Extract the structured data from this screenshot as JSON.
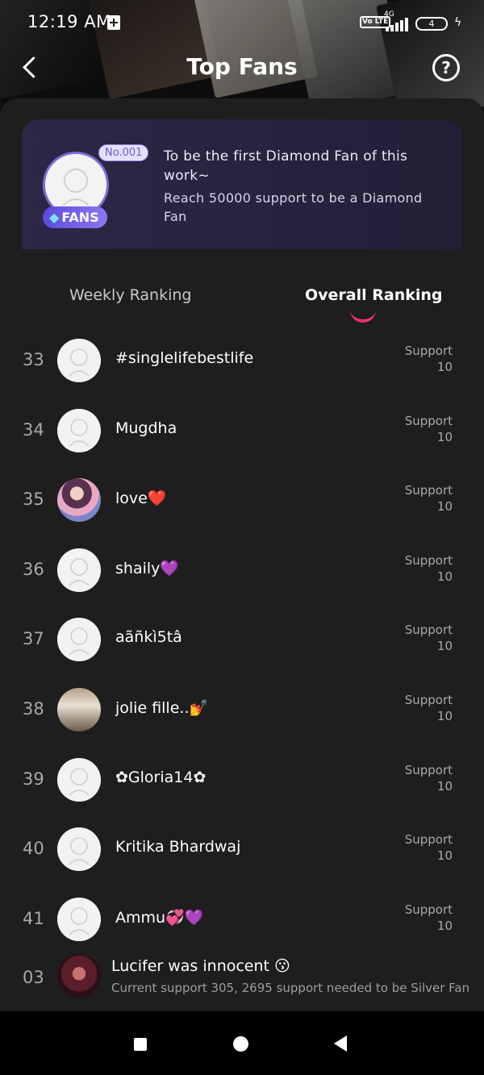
{
  "status_bar": {
    "time": "12:19 AM",
    "network": "4G",
    "volte": "Vo LTE",
    "battery": "4"
  },
  "header": {
    "title": "Top Fans"
  },
  "banner": {
    "rank_badge": "No.001",
    "fans_badge": "FANS",
    "line1": "To be the first Diamond Fan of this work~",
    "line2": "Reach 50000 support to be a Diamond Fan"
  },
  "tabs": [
    {
      "label": "Weekly Ranking",
      "active": false
    },
    {
      "label": "Overall Ranking",
      "active": true
    }
  ],
  "support_label": "Support",
  "rows": [
    {
      "rank": "33",
      "name": "#singlelifebestlife",
      "support": "10"
    },
    {
      "rank": "34",
      "name": "Mugdha",
      "support": "10"
    },
    {
      "rank": "35",
      "name": "love❤️",
      "support": "10"
    },
    {
      "rank": "36",
      "name": "shaily💜",
      "support": "10"
    },
    {
      "rank": "37",
      "name": "aãñkì5tâ",
      "support": "10"
    },
    {
      "rank": "38",
      "name": "jolie fille..💅",
      "support": "10"
    },
    {
      "rank": "39",
      "name": "✿Gloria14✿",
      "support": "10"
    },
    {
      "rank": "40",
      "name": "Kritika Bhardwaj",
      "support": "10"
    },
    {
      "rank": "41",
      "name": "Ammu💞💜",
      "support": "10"
    }
  ],
  "my_entry": {
    "rank": "03",
    "name": "Lucifer was innocent 😗",
    "subtitle": "Current support 305, 2695 support needed to be Silver Fan"
  },
  "colors": {
    "accent": "#ff2f6d",
    "banner_bg": "#2d2747",
    "badge": "#7c6bd9"
  }
}
